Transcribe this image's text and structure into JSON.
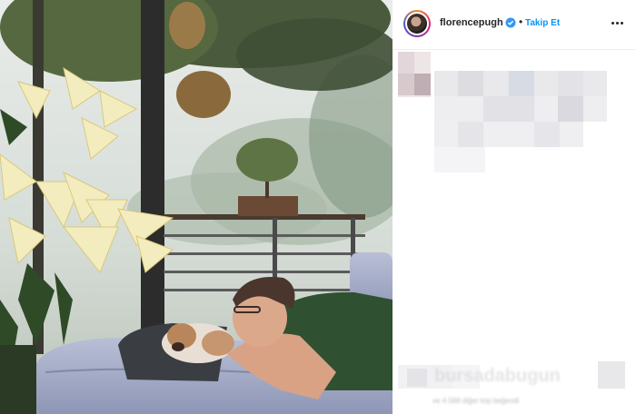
{
  "post": {
    "username": "florencepugh",
    "follow_label": "Takip Et",
    "separator": "•",
    "likes_text": "ve 4.568 diğer kişi beğendi",
    "watermark": "bursadabugun"
  },
  "icons": {
    "verified": "verified-badge-icon",
    "more": "more-options-icon",
    "avatar": "profile-avatar"
  },
  "colors": {
    "accent": "#0095f6",
    "text": "#262626",
    "verified": "#3897f0"
  }
}
